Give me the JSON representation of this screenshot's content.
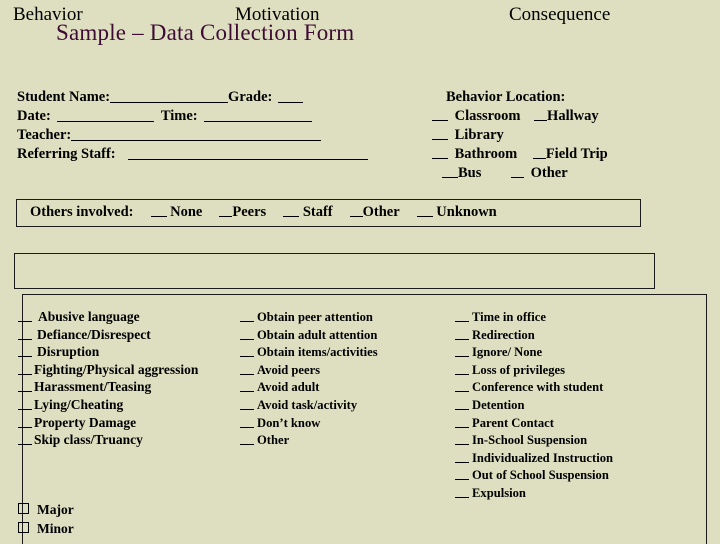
{
  "slide": {
    "title": "Sample – Data Collection Form",
    "background_color": "#dedfc1",
    "title_color": "#3d0b33",
    "border_color": "#1b1b1b"
  },
  "student_info": {
    "lines": [
      {
        "label": "Student Name:",
        "trailing_label": "Grade:"
      },
      {
        "label": "Date:",
        "trailing_label": "Time:"
      },
      {
        "label": "Teacher:",
        "trailing_label": ""
      },
      {
        "label": "Referring Staff:",
        "trailing_label": ""
      }
    ],
    "student_name_label": "Student Name:",
    "grade_label": "Grade:",
    "date_label": "Date:",
    "time_label": "Time:",
    "teacher_label": "Teacher:",
    "referring_staff_label": "Referring Staff:"
  },
  "behavior_location": {
    "heading": "Behavior Location:",
    "rows": [
      [
        "Classroom",
        "Hallway"
      ],
      [
        "Library",
        ""
      ],
      [
        "Bathroom",
        "Field Trip"
      ],
      [
        "Bus",
        "Other"
      ]
    ],
    "items": [
      "Classroom",
      "Hallway",
      "Library",
      "Bathroom",
      "Field Trip",
      "Bus",
      "Other"
    ]
  },
  "others_involved": {
    "label": "Others involved:",
    "options": [
      "None",
      "Peers",
      "Staff",
      "Other",
      "Unknown"
    ]
  },
  "columns": {
    "headers": [
      "Behavior",
      "Motivation",
      "Consequence"
    ],
    "behavior": {
      "header": "Behavior",
      "options": [
        "Abusive language",
        "Defiance/Disrespect",
        "Disruption",
        "Fighting/Physical aggression",
        "Harassment/Teasing",
        "Lying/Cheating",
        "Property Damage",
        "Skip class/Truancy"
      ]
    },
    "motivation": {
      "header": "Motivation",
      "options": [
        "Obtain peer attention",
        "Obtain adult attention",
        "Obtain items/activities",
        "Avoid peers",
        "Avoid adult",
        "Avoid task/activity",
        "Don’t know",
        "Other"
      ]
    },
    "consequence": {
      "header": "Consequence",
      "options": [
        "Time in office",
        "Redirection",
        "Ignore/ None",
        "Loss of privileges",
        "Conference with student",
        "Detention",
        "Parent Contact",
        "In-School Suspension",
        "Individualized Instruction",
        "Out of School Suspension",
        "Expulsion"
      ]
    }
  },
  "severity": {
    "options": [
      "Major",
      "Minor"
    ]
  }
}
